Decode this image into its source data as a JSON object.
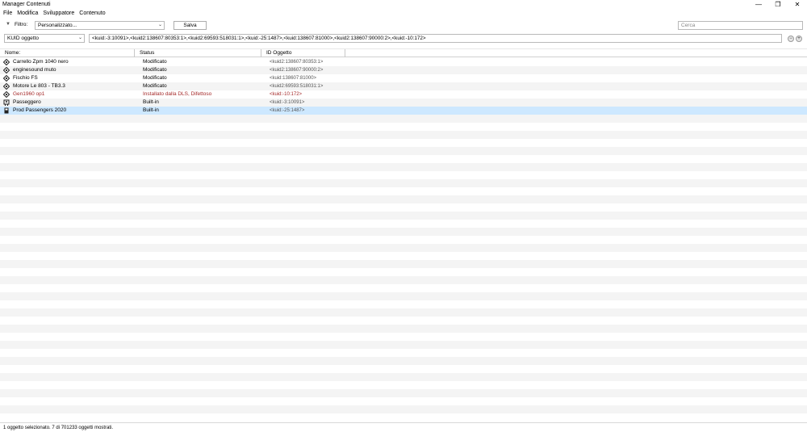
{
  "window": {
    "title": "Manager Contenuti",
    "min": "—",
    "max": "❐",
    "close": "✕"
  },
  "menu": [
    "File",
    "Modifica",
    "Sviluppatore",
    "Contenuto"
  ],
  "toolbar": {
    "filter_label": "Filtro:",
    "filter_value": "Personalizzato...",
    "save_label": "Salva",
    "search_placeholder": "Cerca"
  },
  "query": {
    "field": "KUID oggetto",
    "value": "<kuid:-3:10091>,<kuid2:138607:80353:1>,<kuid2:69593:518031:1>,<kuid:-25:1487>,<kuid:138607:81000>,<kuid2:138607:90000:2>,<kuid:-10:172>"
  },
  "columns": {
    "name": "Nome:",
    "status": "Status",
    "id": "ID Oggetto"
  },
  "rows": [
    {
      "icon": "diamond-icon",
      "name": "Carrello Zpm 1040 nero",
      "status": "Modificato",
      "id": "<kuid2:138607:80353:1>",
      "state": "normal"
    },
    {
      "icon": "diamond-icon",
      "name": "enginesound muto",
      "status": "Modificato",
      "id": "<kuid2:138607:90000:2>",
      "state": "normal"
    },
    {
      "icon": "diamond-icon",
      "name": "Fischio FS",
      "status": "Modificato",
      "id": "<kuid:138607:81000>",
      "state": "normal"
    },
    {
      "icon": "diamond-icon",
      "name": "Motore Le 803 - TB3.3",
      "status": "Modificato",
      "id": "<kuid2:69593:518031:1>",
      "state": "normal"
    },
    {
      "icon": "diamond-icon",
      "name": "Gen1960 op1",
      "status": "Installato dalla DLS, Difettoso",
      "id": "<kuid:-10:172>",
      "state": "error"
    },
    {
      "icon": "passenger-icon",
      "name": "Passeggero",
      "status": "Built-in",
      "id": "<kuid:-3:10091>",
      "state": "normal"
    },
    {
      "icon": "passenger-stop-icon",
      "name": "Prod Passengers 2020",
      "status": "Built-in",
      "id": "<kuid:-25:1487>",
      "state": "selected"
    }
  ],
  "status_bar": "1 oggetto selezionato. 7 di 701233 oggetti mostrati.",
  "colors": {
    "selected": "#cde8ff",
    "error": "#a52a2a",
    "stripe": "#f4f4f4"
  }
}
